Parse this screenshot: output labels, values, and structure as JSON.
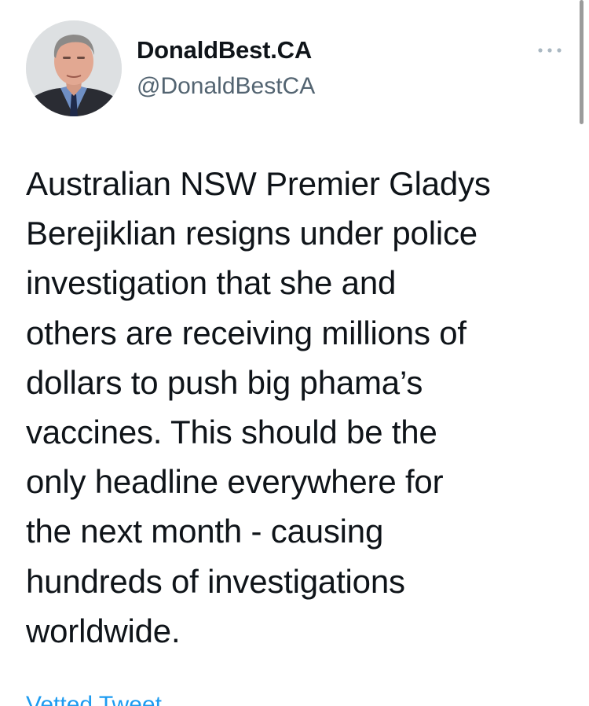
{
  "author": {
    "display_name": "DonaldBest.CA",
    "handle": "@DonaldBestCA"
  },
  "more_icon": "more-horizontal-icon",
  "tweet": {
    "lines": [
      "Australian NSW Premier Gladys",
      "Berejiklian resigns under police",
      "investigation that she and",
      "others are receiving millions of",
      "dollars to push big phama’s",
      "vaccines. This should be the",
      "only headline everywhere for",
      "the next month - causing",
      "hundreds of investigations",
      "worldwide."
    ]
  },
  "footer": {
    "link_label": "Vetted Tweet"
  },
  "colors": {
    "text_primary": "#0f1419",
    "text_secondary": "#536471",
    "link": "#1d9bf0",
    "background": "#ffffff"
  }
}
